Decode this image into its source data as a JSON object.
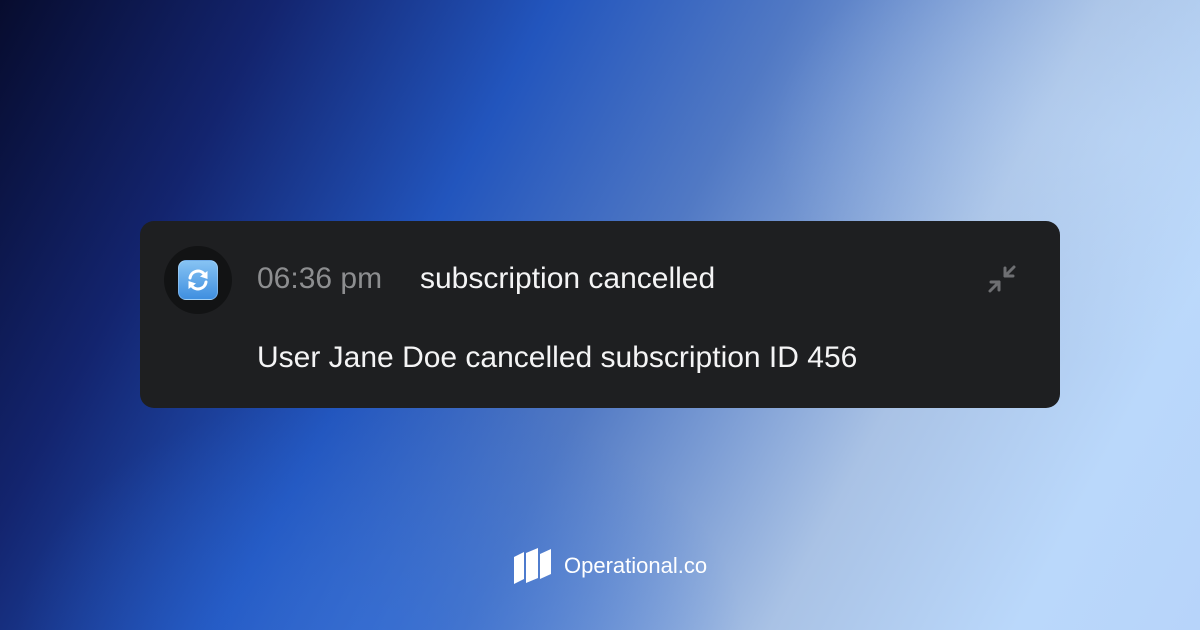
{
  "notification": {
    "app_icon": "anticlockwise-arrows-icon",
    "time": "06:36 pm",
    "title": "subscription cancelled",
    "message": "User Jane Doe cancelled subscription ID 456",
    "collapse_icon": "collapse-arrows-icon"
  },
  "brand": {
    "logo_icon": "operational-logo-icon",
    "name": "Operational.co"
  },
  "colors": {
    "card_background": "#1e1f21",
    "time_text": "#8d8e90",
    "primary_text": "#f4f4f5",
    "icon_muted": "#6e6f72",
    "brand_text": "#ffffff"
  }
}
